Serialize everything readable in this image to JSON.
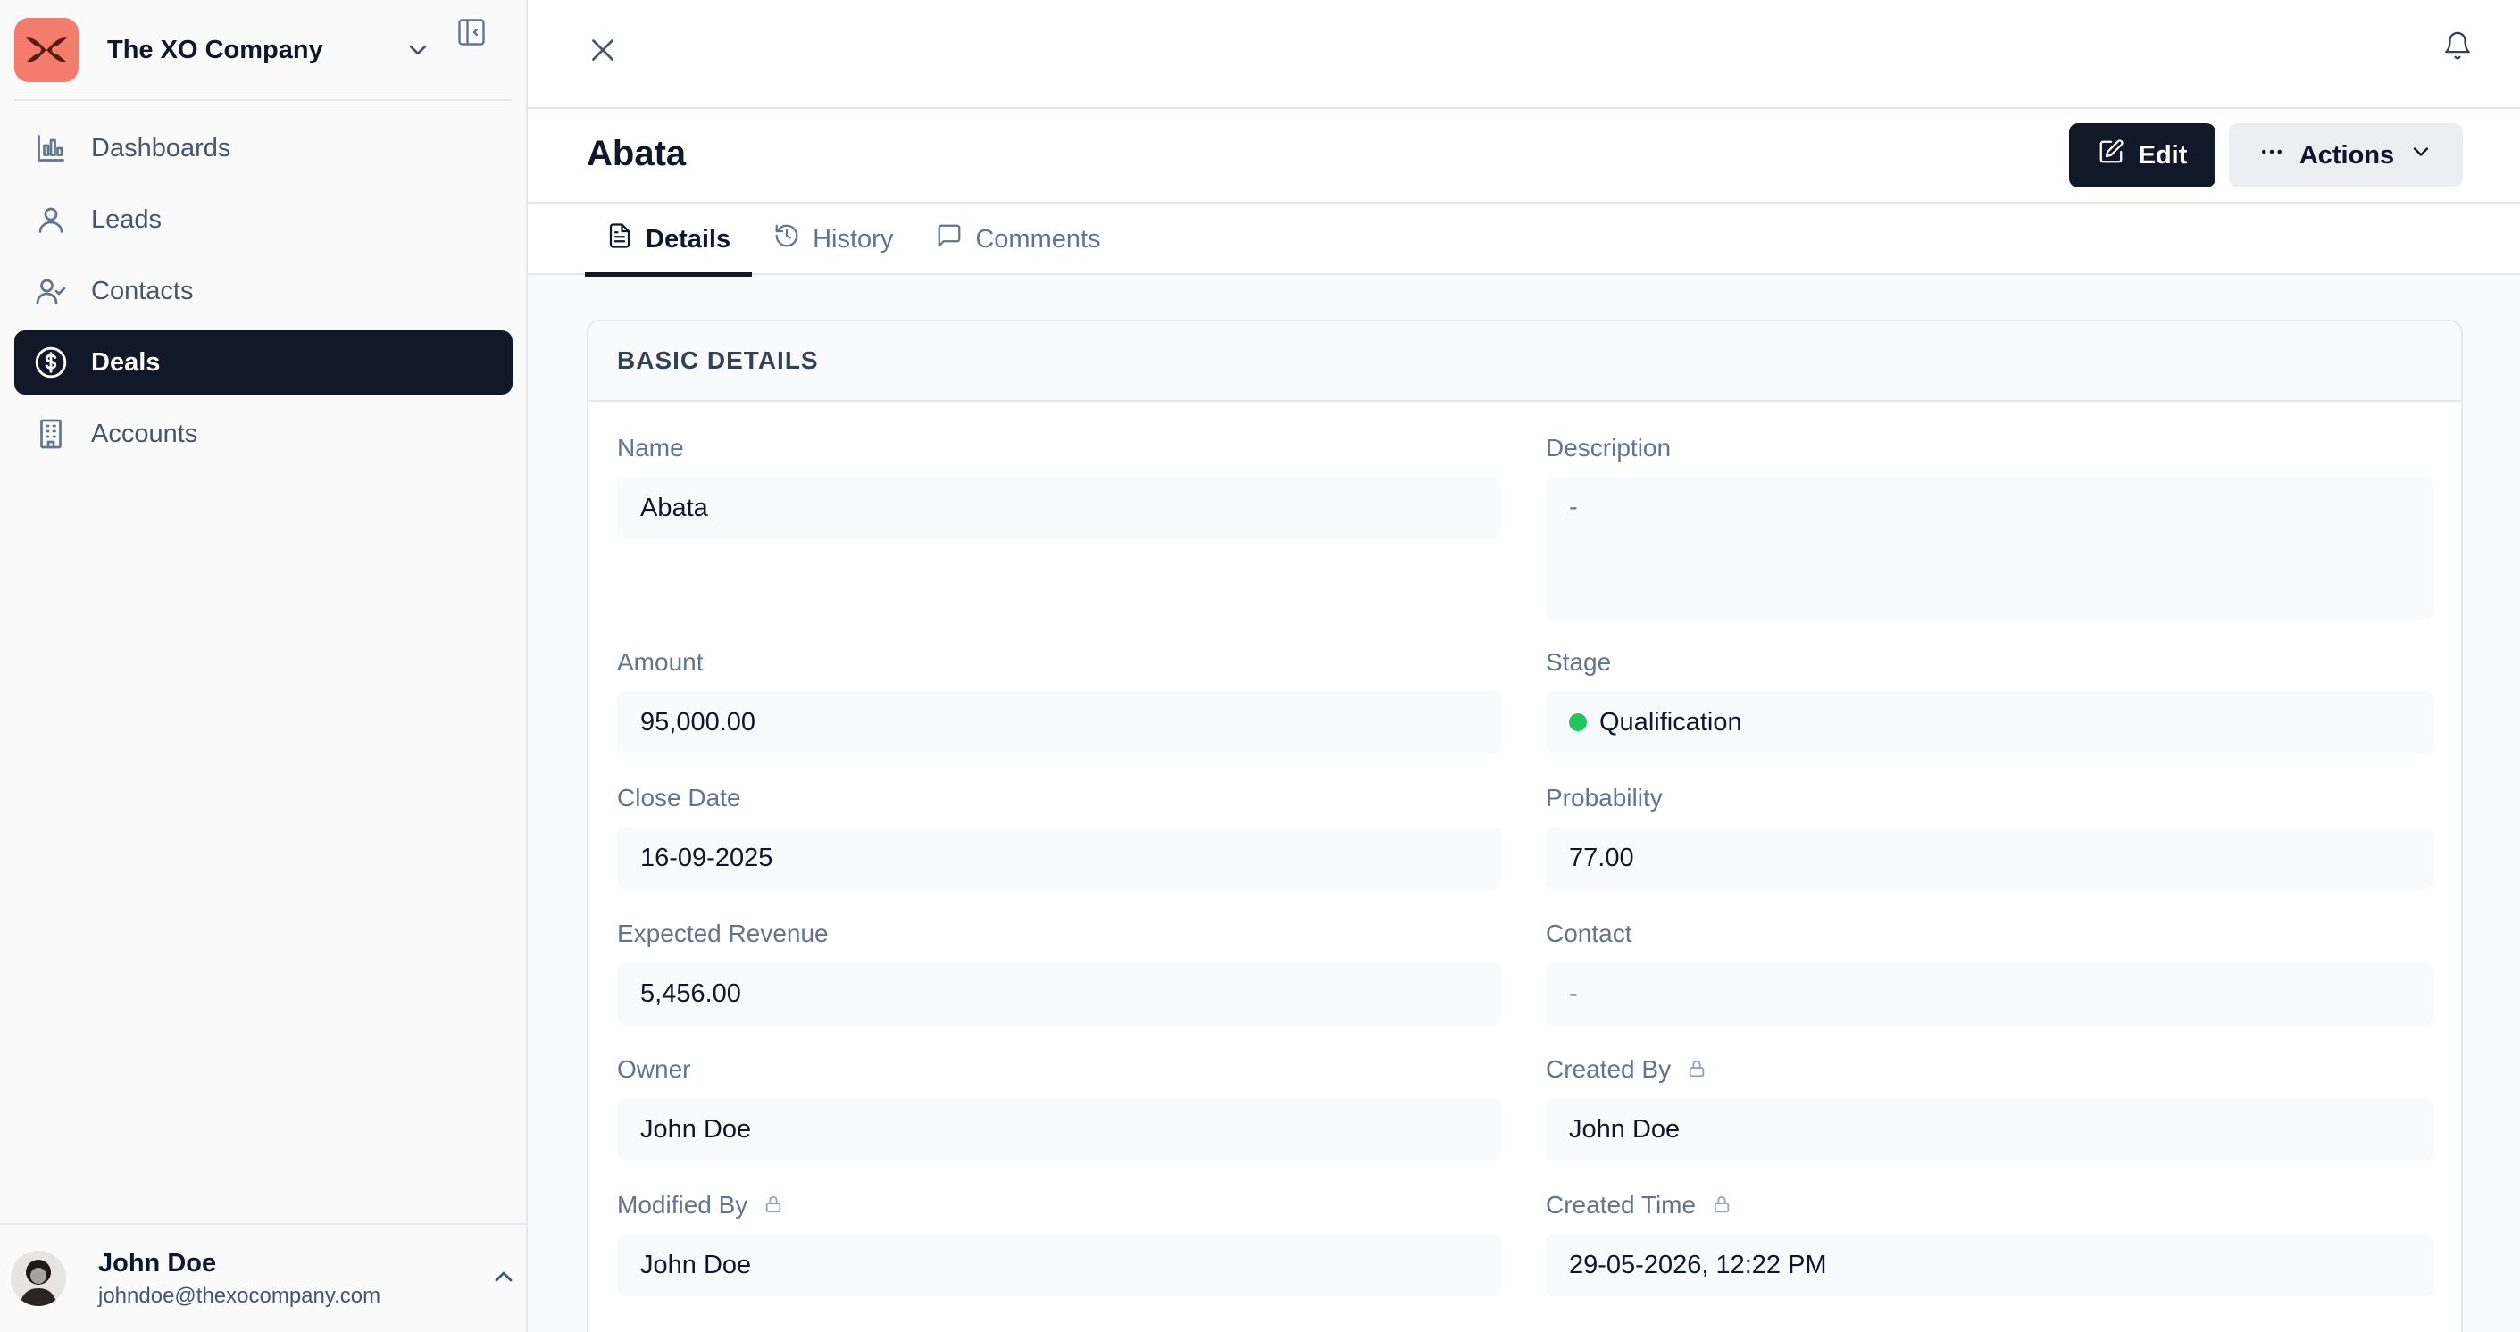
{
  "sidebar": {
    "org_name": "The XO Company",
    "nav": [
      {
        "label": "Dashboards",
        "icon": "bar-chart-icon"
      },
      {
        "label": "Leads",
        "icon": "user-icon"
      },
      {
        "label": "Contacts",
        "icon": "user-check-icon"
      },
      {
        "label": "Deals",
        "icon": "dollar-circle-icon",
        "active": true
      },
      {
        "label": "Accounts",
        "icon": "building-icon"
      }
    ],
    "user": {
      "name": "John Doe",
      "email": "johndoe@thexocompany.com"
    }
  },
  "record": {
    "title": "Abata",
    "edit_label": "Edit",
    "actions_label": "Actions"
  },
  "tabs": [
    {
      "label": "Details",
      "active": true
    },
    {
      "label": "History"
    },
    {
      "label": "Comments"
    }
  ],
  "section": {
    "title": "BASIC DETAILS",
    "fields": {
      "name": {
        "label": "Name",
        "value": "Abata"
      },
      "description": {
        "label": "Description",
        "value": "-"
      },
      "amount": {
        "label": "Amount",
        "value": "95,000.00"
      },
      "stage": {
        "label": "Stage",
        "value": "Qualification",
        "color": "#22c55e"
      },
      "close_date": {
        "label": "Close Date",
        "value": "16-09-2025"
      },
      "probability": {
        "label": "Probability",
        "value": "77.00"
      },
      "expected_revenue": {
        "label": "Expected Revenue",
        "value": "5,456.00"
      },
      "contact": {
        "label": "Contact",
        "value": "-"
      },
      "owner": {
        "label": "Owner",
        "value": "John Doe"
      },
      "created_by": {
        "label": "Created By",
        "value": "John Doe",
        "locked": true
      },
      "modified_by": {
        "label": "Modified By",
        "value": "John Doe",
        "locked": true
      },
      "created_time": {
        "label": "Created Time",
        "value": "29-05-2026, 12:22 PM",
        "locked": true
      }
    }
  },
  "colors": {
    "primary": "#111827",
    "logo_bg": "#f47c6c",
    "stage_dot": "#22c55e"
  }
}
